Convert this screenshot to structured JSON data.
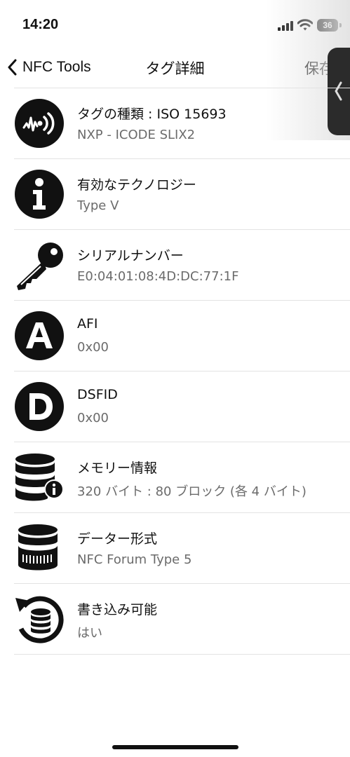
{
  "status_bar": {
    "time": "14:20",
    "battery": "36"
  },
  "nav": {
    "back_label": "NFC Tools",
    "title": "タグ詳細",
    "save_label": "保存"
  },
  "rows": [
    {
      "icon": "nfc-tag-icon",
      "title": "タグの種類 : ISO 15693",
      "value": "NXP - ICODE SLIX2"
    },
    {
      "icon": "info-icon",
      "title": "有効なテクノロジー",
      "value": "Type V"
    },
    {
      "icon": "key-icon",
      "title": "シリアルナンバー",
      "value": "E0:04:01:08:4D:DC:77:1F"
    },
    {
      "icon": "letter-a-icon",
      "title": "AFI",
      "value": "0x00"
    },
    {
      "icon": "letter-d-icon",
      "title": "DSFID",
      "value": "0x00"
    },
    {
      "icon": "database-info-icon",
      "title": "メモリー情報",
      "value": "320 バイト : 80 ブロック (各 4 バイト)"
    },
    {
      "icon": "database-barcode-icon",
      "title": "データー形式",
      "value": "NFC Forum Type 5"
    },
    {
      "icon": "database-rotate-icon",
      "title": "書き込み可能",
      "value": "はい"
    }
  ],
  "colors": {
    "icon": "#111111",
    "subtitle": "#6b6b6b",
    "divider": "#e3e3e3"
  }
}
